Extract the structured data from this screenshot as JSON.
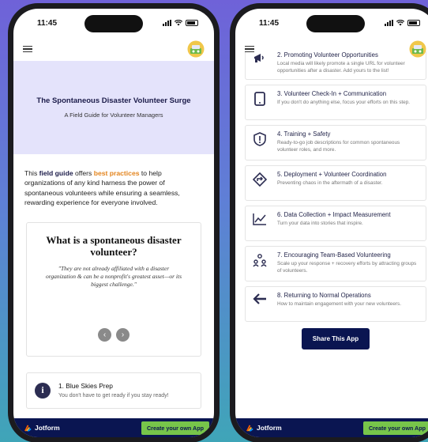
{
  "left_phone": {
    "status_time": "11:45",
    "hero_title": "The Spontaneous Disaster Volunteer Surge",
    "hero_subtitle": "A Field Guide for Volunteer Managers",
    "intro": {
      "pre": "This ",
      "kw": "field guide",
      "mid": " offers ",
      "hl": "best practices",
      "post": " to help organizations of any kind harness the power of spontaneous volunteers while ensuring a seamless, rewarding experience for everyone involved."
    },
    "card_heading": "What is a spontaneous disaster volunteer?",
    "card_quote": "\"They are not already affiliated with a disaster organization & can be a nonprofit's greatest asset—or its biggest challenge.\"",
    "prev_glyph": "‹",
    "next_glyph": "›",
    "prep_title": "1. Blue Skies Prep",
    "prep_desc": "You don't have to get ready if you stay ready!",
    "info_glyph": "i"
  },
  "right_phone": {
    "status_time": "11:45",
    "items": [
      {
        "icon": "megaphone-icon",
        "title": "2. Promoting Volunteer Opportunities",
        "desc": "Local media will likely promote a single URL for volunteer opportunities after a disaster. Add yours to the list!"
      },
      {
        "icon": "tablet-icon",
        "title": "3. Volunteer Check-In + Communication",
        "desc": "If you don't do anything else, focus your efforts on this step."
      },
      {
        "icon": "shield-alert-icon",
        "title": "4. Training + Safety",
        "desc": "Ready-to-go job descriptions for common spontaneous volunteer roles, and more."
      },
      {
        "icon": "directions-icon",
        "title": "5. Deployment + Volunteer Coordination",
        "desc": "Preventing chaos in the aftermath of a disaster."
      },
      {
        "icon": "trend-chart-icon",
        "title": "6. Data Collection + Impact Measurement",
        "desc": "Turn your data into stories that inspire."
      },
      {
        "icon": "team-icon",
        "title": "7. Encouraging Team-Based Volunteering",
        "desc": "Scale up your response + recovery efforts by attracting groups of volunteers."
      },
      {
        "icon": "arrow-left-icon",
        "title": "8. Returning to Normal Operations",
        "desc": "How to maintain engagement with your new volunteers."
      }
    ],
    "share_label": "Share This App"
  },
  "footer": {
    "brand": "Jotform",
    "cta": "Create your own App"
  },
  "colors": {
    "navy": "#0a1551",
    "accent_orange": "#e3841d",
    "cta_green": "#77c54a",
    "hero_bg": "#e4e3fb"
  }
}
